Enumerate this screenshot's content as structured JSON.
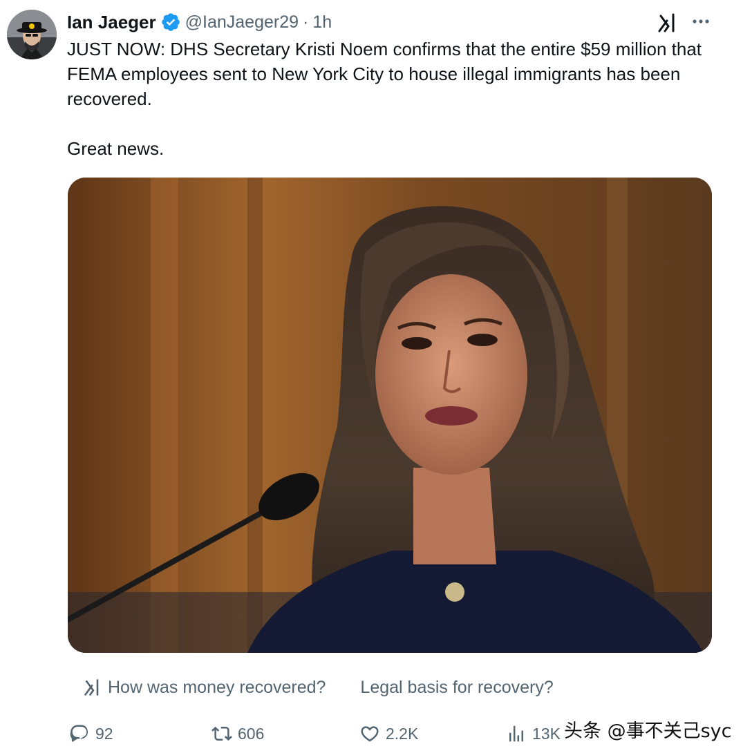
{
  "author": {
    "name": "Ian Jaeger",
    "handle": "@IanJaeger29",
    "time": "1h",
    "separator": "·",
    "verified_color": "#1d9bf0"
  },
  "tweet": {
    "text": "JUST NOW: DHS Secretary Kristi Noem confirms that the entire $59 million that FEMA employees sent to New York City to house illegal immigrants has been recovered.\n\nGreat news."
  },
  "suggestions": [
    {
      "label": "How was money recovered?",
      "icon": "grok-icon"
    },
    {
      "label": "Legal basis for recovery?",
      "icon": ""
    }
  ],
  "metrics": {
    "replies": "92",
    "reposts": "606",
    "likes": "2.2K",
    "views": "13K"
  },
  "icons": {
    "top_right": [
      "grok-icon",
      "more-options-icon"
    ],
    "actions": [
      "reply-icon",
      "repost-icon",
      "like-icon",
      "views-icon"
    ]
  },
  "watermark": "头条 @事不关己syc",
  "colors": {
    "text": "#0f1419",
    "secondary": "#536471",
    "background": "#ffffff"
  }
}
